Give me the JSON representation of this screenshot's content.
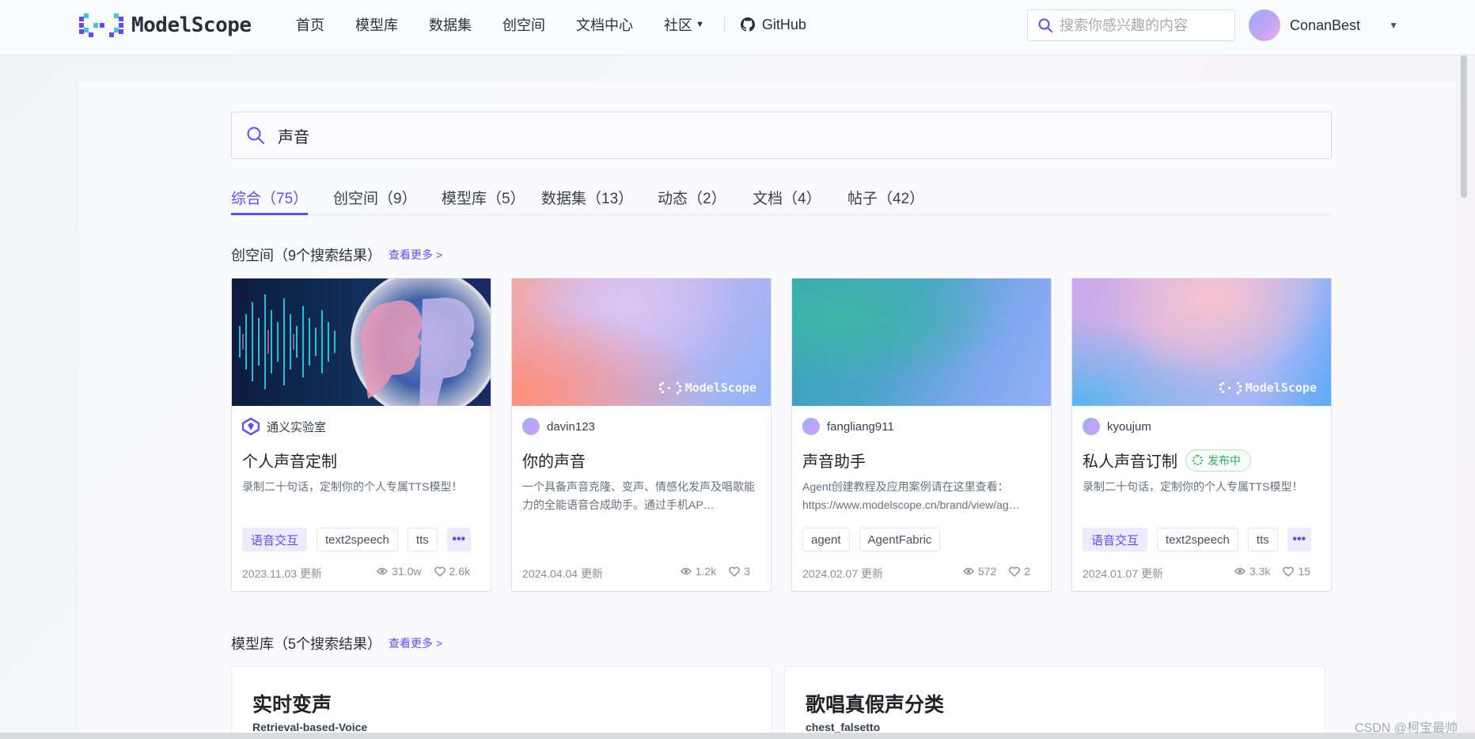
{
  "brand": {
    "name": "ModelScope"
  },
  "nav": {
    "links": [
      "首页",
      "模型库",
      "数据集",
      "创空间",
      "文档中心",
      "社区"
    ],
    "github": "GitHub"
  },
  "header_search": {
    "placeholder": "搜索你感兴趣的内容"
  },
  "user": {
    "name": "ConanBest"
  },
  "search": {
    "query": "声音"
  },
  "tabs": [
    {
      "label": "综合（75）",
      "active": true
    },
    {
      "label": "创空间（9）"
    },
    {
      "label": "模型库（5）"
    },
    {
      "label": "数据集（13）"
    },
    {
      "label": "动态（2）"
    },
    {
      "label": "文档（4）"
    },
    {
      "label": "帖子（42）"
    }
  ],
  "studios": {
    "title": "创空间（9个搜索结果）",
    "see_more": "查看更多 >",
    "cards": [
      {
        "owner": "通义实验室",
        "title": "个人声音定制",
        "desc": "录制二十句话，定制你的个人专属TTS模型！",
        "tags": [
          "语音交互",
          "text2speech",
          "tts"
        ],
        "date": "2023.11.03 更新",
        "views": "31.0w",
        "likes": "2.6k"
      },
      {
        "owner": "davin123",
        "title": "你的声音",
        "desc": "一个具备声音克隆、变声、情感化发声及唱歌能力的全能语音合成助手。通过手机AP…",
        "tags": [],
        "date": "2024.04.04 更新",
        "views": "1.2k",
        "likes": "3",
        "cover_watermark": "ModelScope"
      },
      {
        "owner": "fangliang911",
        "title": "声音助手",
        "desc": "Agent创建教程及应用案例请在这里查看：https://www.modelscope.cn/brand/view/ag…",
        "tags": [
          "agent",
          "AgentFabric"
        ],
        "date": "2024.02.07 更新",
        "views": "572",
        "likes": "2"
      },
      {
        "owner": "kyoujum",
        "title": "私人声音订制",
        "status": "发布中",
        "desc": "录制二十句话，定制你的个人专属TTS模型！",
        "tags": [
          "语音交互",
          "text2speech",
          "tts"
        ],
        "date": "2024.01.07 更新",
        "views": "3.3k",
        "likes": "15",
        "cover_watermark": "ModelScope"
      }
    ]
  },
  "models": {
    "title": "模型库（5个搜索结果）",
    "see_more": "查看更多 >",
    "cards": [
      {
        "title": "实时变声",
        "subtitle": "Retrieval-based-Voice"
      },
      {
        "title": "歌唱真假声分类",
        "subtitle": "chest_falsetto"
      }
    ]
  },
  "watermark": "CSDN @柯宝最帅",
  "colors": {
    "accent": "#624aff",
    "status_green": "#2fb05c"
  }
}
